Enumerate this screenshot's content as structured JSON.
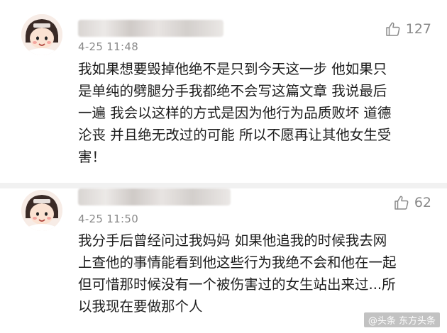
{
  "comments": [
    {
      "time": "4-25 11:48",
      "likes": "127",
      "text": "我如果想要毁掉他绝不是只到今天这一步 他如果只\n是单纯的劈腿分手我都绝不会写这篇文章 我说最后\n一遍 我会以这样的方式是因为他行为品质败坏 道德\n沦丧 并且绝无改过的可能 所以不愿再让其他女生受\n害！"
    },
    {
      "time": "4-25 11:50",
      "likes": "62",
      "text": "我分手后曾经问过我妈妈 如果他追我的时候我去网\n上查他的事情能看到他这些行为我绝不会和他在一起\n但可惜那时候没有一个被伤害过的女生站出来过...所\n以我现在要做那个人"
    }
  ],
  "icons": {
    "like": "thumbs-up-icon",
    "avatar": "cartoon-girl-avatar"
  },
  "watermark": "@头条 东方头条",
  "colors": {
    "text": "#1c1c1c",
    "meta": "#8a8a8a",
    "separator": "#f1f1f1"
  }
}
